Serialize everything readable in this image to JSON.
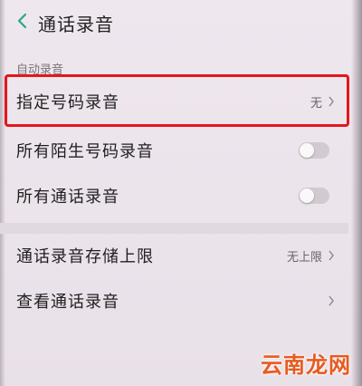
{
  "header": {
    "title": "通话录音"
  },
  "section": {
    "auto_record_label": "自动录音"
  },
  "rows": {
    "specified_numbers": {
      "label": "指定号码录音",
      "value": "无"
    },
    "unknown_numbers": {
      "label": "所有陌生号码录音",
      "toggle_on": false
    },
    "all_calls": {
      "label": "所有通话录音",
      "toggle_on": false
    },
    "storage_limit": {
      "label": "通话录音存储上限",
      "value": "无上限"
    },
    "view_recordings": {
      "label": "查看通话录音"
    }
  },
  "watermark": {
    "text": "云南龙网"
  },
  "colors": {
    "highlight_border": "#e2171d",
    "back_arrow": "#2aa58a",
    "watermark": "#e85a1f"
  }
}
